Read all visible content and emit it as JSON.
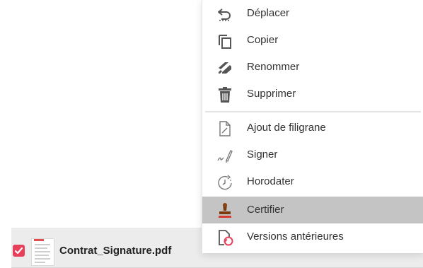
{
  "menu": {
    "items": [
      {
        "label": "Déplacer",
        "icon": "move-icon"
      },
      {
        "label": "Copier",
        "icon": "copy-icon"
      },
      {
        "label": "Renommer",
        "icon": "rename-icon"
      },
      {
        "label": "Supprimer",
        "icon": "trash-icon"
      },
      {
        "label": "Ajout de filigrane",
        "icon": "watermark-icon"
      },
      {
        "label": "Signer",
        "icon": "sign-icon"
      },
      {
        "label": "Horodater",
        "icon": "timestamp-icon"
      },
      {
        "label": "Certifier",
        "icon": "certify-icon"
      },
      {
        "label": "Versions antérieures",
        "icon": "history-icon"
      }
    ],
    "active_item": "Certifier"
  },
  "file": {
    "name": "Contrat_Signature.pdf",
    "checked": true,
    "check_color": "#e8405a"
  },
  "colors": {
    "highlight": "#c4c4c4",
    "accent": "#e8405a"
  }
}
